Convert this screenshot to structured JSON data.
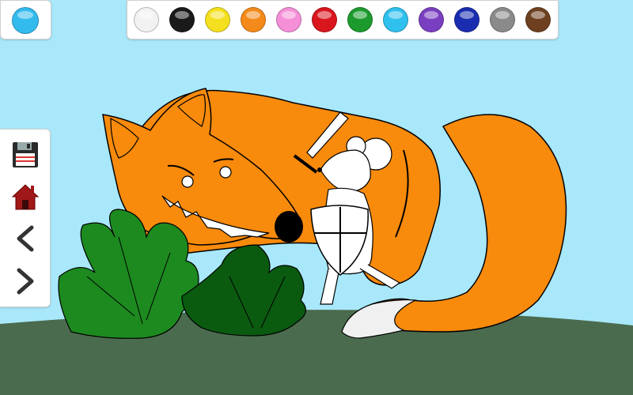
{
  "app": {
    "current_color": "#33bbee"
  },
  "palette": [
    {
      "name": "white",
      "hex": "#f2f2f2"
    },
    {
      "name": "black",
      "hex": "#1a1a1a"
    },
    {
      "name": "yellow",
      "hex": "#f4e01e"
    },
    {
      "name": "orange",
      "hex": "#f48a1a"
    },
    {
      "name": "pink",
      "hex": "#f58fd8"
    },
    {
      "name": "red",
      "hex": "#d9161e"
    },
    {
      "name": "green",
      "hex": "#1d9a2e"
    },
    {
      "name": "light-blue",
      "hex": "#2fc0ee"
    },
    {
      "name": "purple",
      "hex": "#7a3fc0"
    },
    {
      "name": "dark-blue",
      "hex": "#1a2db0"
    },
    {
      "name": "gray",
      "hex": "#8a8a8a"
    },
    {
      "name": "brown",
      "hex": "#6e4020"
    }
  ],
  "tools": [
    {
      "name": "save",
      "icon": "floppy-disk-icon"
    },
    {
      "name": "home",
      "icon": "house-icon"
    },
    {
      "name": "previous",
      "icon": "chevron-left-icon"
    },
    {
      "name": "next",
      "icon": "chevron-right-icon"
    }
  ],
  "scene": {
    "sky_color": "#a8e8fa",
    "ground_color": "#4b6b4e",
    "fox_color": "#f88a0c",
    "bush_left_color": "#1d8a20",
    "bush_right_color": "#0a5a10",
    "mouse_color": "#ffffff"
  }
}
